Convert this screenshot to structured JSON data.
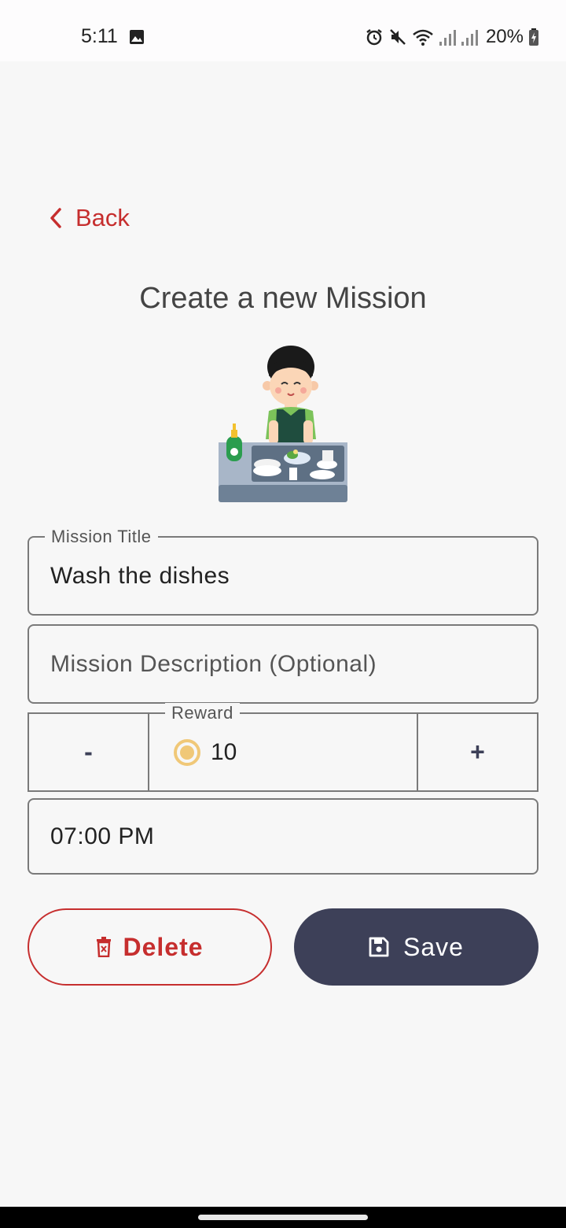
{
  "status_bar": {
    "time": "5:11",
    "battery": "20%"
  },
  "nav": {
    "back_label": "Back"
  },
  "page_title": "Create a new Mission",
  "form": {
    "title_label": "Mission Title",
    "title_value": "Wash the dishes",
    "description_placeholder": "Mission Description (Optional)",
    "reward_label": "Reward",
    "reward_value": "10",
    "decrement_label": "-",
    "increment_label": "+",
    "time_value": "07:00 PM"
  },
  "actions": {
    "delete_label": "Delete",
    "save_label": "Save"
  },
  "colors": {
    "accent_red": "#c62e2e",
    "primary_navy": "#3d4058",
    "coin": "#f0c878"
  }
}
